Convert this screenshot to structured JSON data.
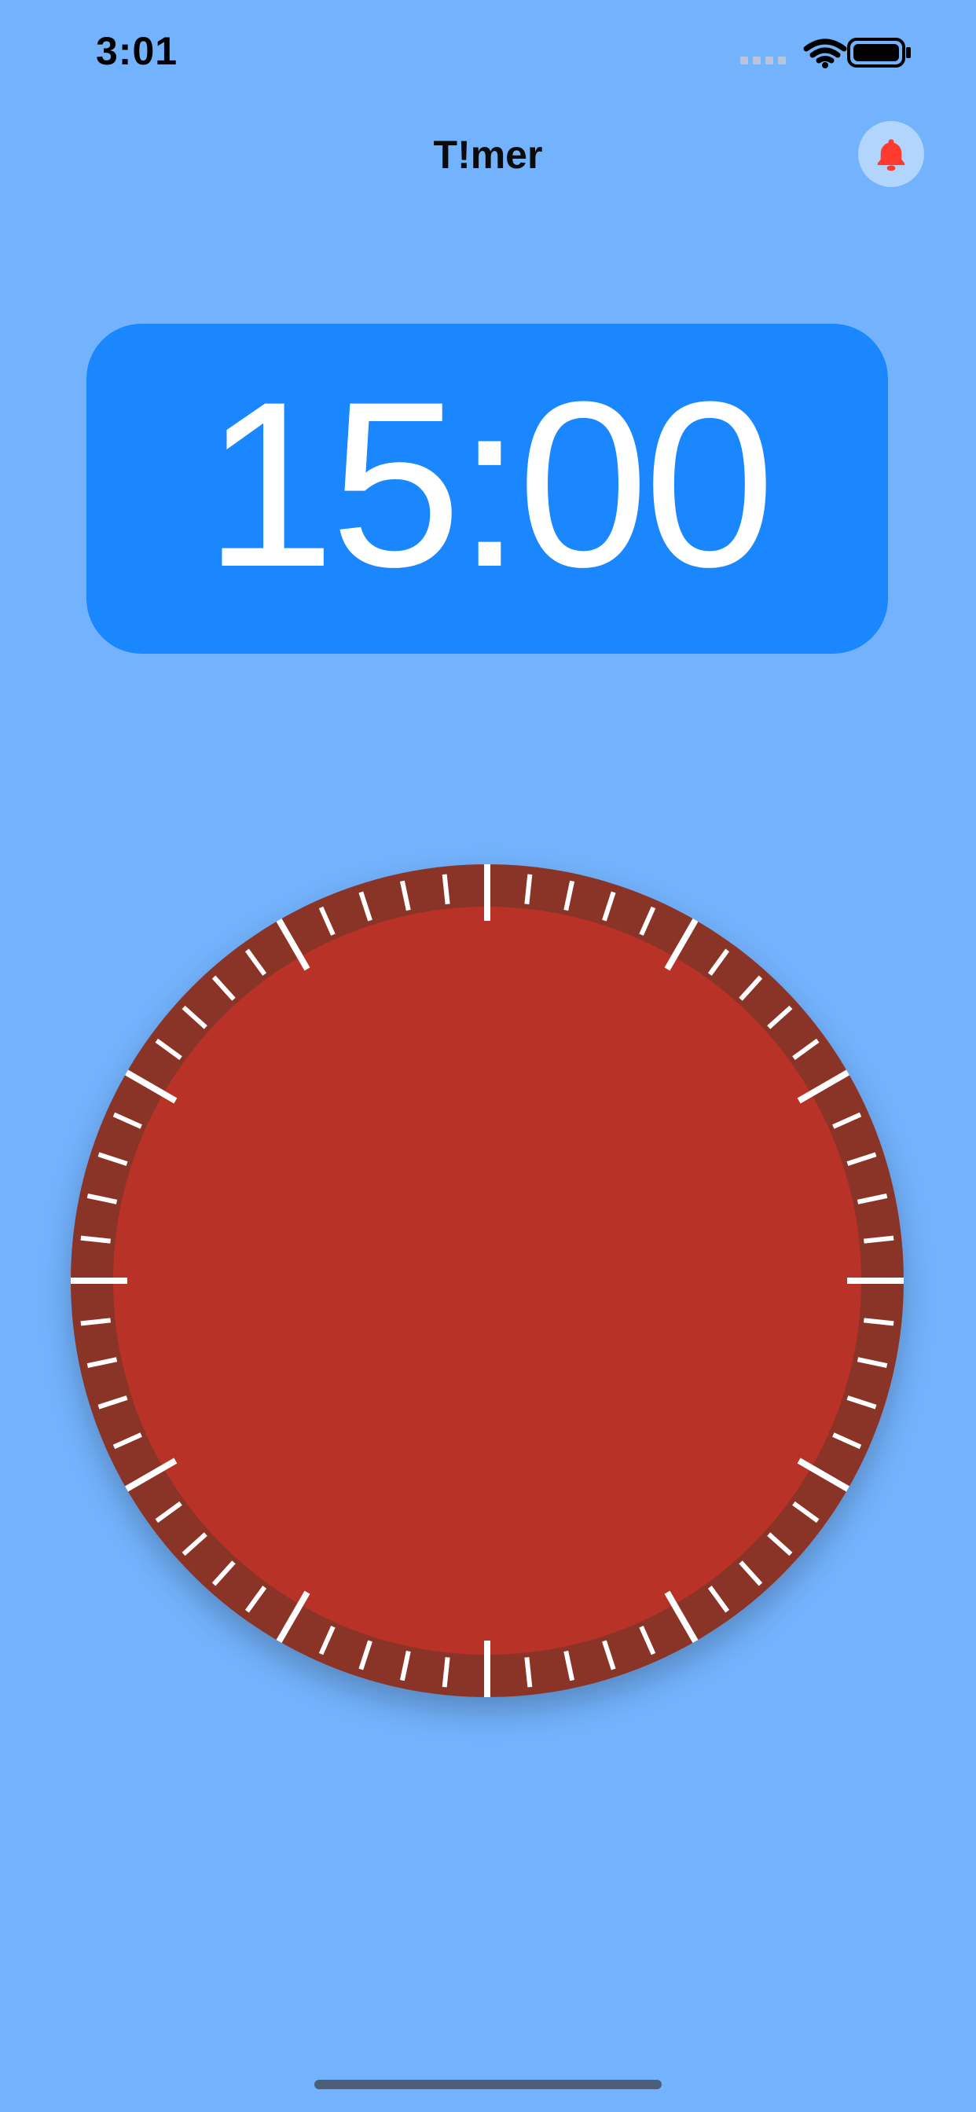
{
  "status_bar": {
    "time": "3:01"
  },
  "nav": {
    "title": "T!mer"
  },
  "timer": {
    "display": "15:00"
  },
  "dial": {
    "tick_count": 60,
    "major_every": 5
  },
  "colors": {
    "background": "#73b3fd",
    "card": "#1a87ff",
    "dial_face": "#b83228",
    "dial_ring": "#8a3428",
    "bell": "#ff3b30"
  },
  "icons": {
    "bell": "bell-icon",
    "wifi": "wifi-icon",
    "battery": "battery-icon",
    "signal": "cellular-signal-icon"
  }
}
